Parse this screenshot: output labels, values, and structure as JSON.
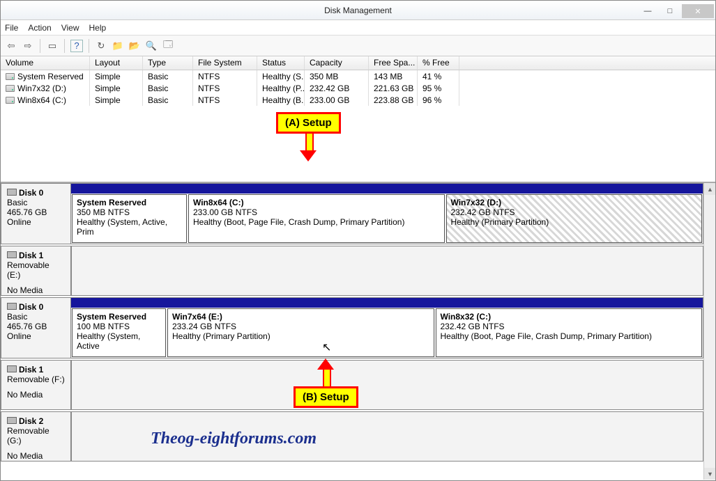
{
  "window": {
    "title": "Disk Management",
    "minimize": "—",
    "maximize": "□",
    "close": "✕"
  },
  "menu": {
    "file": "File",
    "action": "Action",
    "view": "View",
    "help": "Help"
  },
  "toolbar": {
    "back": "⇦",
    "fwd": "⇨",
    "show": "▭",
    "help": "?",
    "refresh": "↻",
    "folder": "📁",
    "open": "📂",
    "search": "🔍",
    "props": "🗔"
  },
  "columns": {
    "volume": "Volume",
    "layout": "Layout",
    "type": "Type",
    "fs": "File System",
    "status": "Status",
    "capacity": "Capacity",
    "free": "Free Spa...",
    "pfree": "% Free"
  },
  "volumes": [
    {
      "name": "System Reserved",
      "layout": "Simple",
      "type": "Basic",
      "fs": "NTFS",
      "status": "Healthy (S...",
      "cap": "350 MB",
      "free": "143 MB",
      "pfree": "41 %"
    },
    {
      "name": "Win7x32 (D:)",
      "layout": "Simple",
      "type": "Basic",
      "fs": "NTFS",
      "status": "Healthy (P...",
      "cap": "232.42 GB",
      "free": "221.63 GB",
      "pfree": "95 %"
    },
    {
      "name": "Win8x64 (C:)",
      "layout": "Simple",
      "type": "Basic",
      "fs": "NTFS",
      "status": "Healthy (B...",
      "cap": "233.00 GB",
      "free": "223.88 GB",
      "pfree": "96 %"
    }
  ],
  "diskA": {
    "label": {
      "name": "Disk 0",
      "type": "Basic",
      "size": "465.76 GB",
      "status": "Online"
    },
    "p1": {
      "name": "System Reserved",
      "size": "350 MB NTFS",
      "status": "Healthy (System, Active, Prim"
    },
    "p2": {
      "name": "Win8x64  (C:)",
      "size": "233.00 GB NTFS",
      "status": "Healthy (Boot, Page File, Crash Dump, Primary Partition)"
    },
    "p3": {
      "name": "Win7x32  (D:)",
      "size": "232.42 GB NTFS",
      "status": "Healthy (Primary Partition)"
    }
  },
  "disk1a": {
    "name": "Disk 1",
    "sub": "Removable (E:)",
    "nomedia": "No Media"
  },
  "diskB": {
    "label": {
      "name": "Disk 0",
      "type": "Basic",
      "size": "465.76 GB",
      "status": "Online"
    },
    "p1": {
      "name": "System Reserved",
      "size": "100 MB NTFS",
      "status": "Healthy (System, Active"
    },
    "p2": {
      "name": "Win7x64  (E:)",
      "size": "233.24 GB NTFS",
      "status": "Healthy (Primary Partition)"
    },
    "p3": {
      "name": "Win8x32  (C:)",
      "size": "232.42 GB NTFS",
      "status": "Healthy (Boot, Page File, Crash Dump, Primary Partition)"
    }
  },
  "disk1b": {
    "name": "Disk 1",
    "sub": "Removable (F:)",
    "nomedia": "No Media"
  },
  "disk2b": {
    "name": "Disk 2",
    "sub": "Removable (G:)",
    "nomedia": "No Media"
  },
  "annotA": "(A)  Setup",
  "annotB": "(B)  Setup",
  "watermark": "Theog-eightforums.com"
}
